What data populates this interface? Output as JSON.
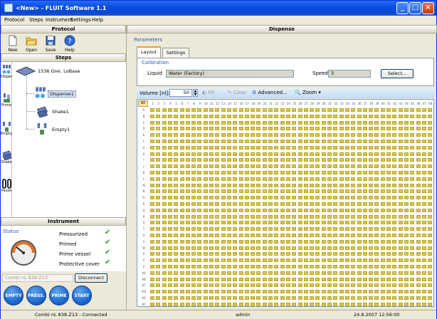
{
  "window": {
    "title": "<New> - FLUIT Software 1.1"
  },
  "menu": [
    {
      "label": "Protocol",
      "accel": "P"
    },
    {
      "label": "Steps",
      "accel": "S"
    },
    {
      "label": "Instrument",
      "accel": "I"
    },
    {
      "label": "Settings",
      "accel": "S"
    },
    {
      "label": "Help",
      "accel": "H"
    }
  ],
  "protocol": {
    "header": "Protocol",
    "toolbar": [
      {
        "name": "new",
        "label": "New",
        "icon": "new-file-icon"
      },
      {
        "name": "open",
        "label": "Open",
        "icon": "folder-open-icon"
      },
      {
        "name": "save",
        "label": "Save",
        "icon": "floppy-disk-icon"
      },
      {
        "name": "help",
        "label": "Help",
        "icon": "help-icon"
      }
    ]
  },
  "steps": {
    "header": "Steps",
    "palette": [
      {
        "label": "Dispense",
        "icon": "dispense-icon"
      },
      {
        "label": "Prime",
        "icon": "prime-icon"
      },
      {
        "label": "Empty",
        "icon": "empty-icon"
      },
      {
        "label": "Shake",
        "icon": "shake-icon"
      },
      {
        "label": "Pause",
        "icon": "pause-icon"
      }
    ],
    "tree": {
      "root": "1536 Grei. LoBase",
      "children": [
        "Dispense1",
        "Shake1",
        "Empty1"
      ]
    }
  },
  "instrument": {
    "header": "Instrument",
    "status_label": "Status",
    "checks": [
      "Pressurized",
      "Primed",
      "Prime vessel",
      "Protective cover"
    ],
    "connection_field": "Combi nL 838-Z13",
    "disconnect_label": "Disconnect",
    "action_buttons": [
      "EMPTY",
      "PRESS.",
      "PRIME",
      "START"
    ]
  },
  "dispense": {
    "header": "Dispense",
    "group_label": "Parameters",
    "tabs": [
      "Layout",
      "Settings"
    ],
    "calibration": {
      "label": "Calibration",
      "liquid_label": "Liquid",
      "liquid_value": "Water (Factory)",
      "speed_label": "Speed:",
      "speed_value": "3",
      "select_label": "Select..."
    },
    "toolbar": {
      "volume_label": "Volume [nl]:",
      "volume_value": "50",
      "fill_label": "Fill",
      "clear_label": "Clear",
      "advanced_label": "Advanced...",
      "zoom_label": "Zoom"
    },
    "plate": {
      "all_label": "All",
      "columns": 48,
      "rows": 32,
      "cell_value": "50",
      "accent": "#d8c84a"
    }
  },
  "status_bar": {
    "connection": "Combi nL 838-Z13 - Connected",
    "user": "admin",
    "datetime": "24.8.2007 12:56:00"
  }
}
